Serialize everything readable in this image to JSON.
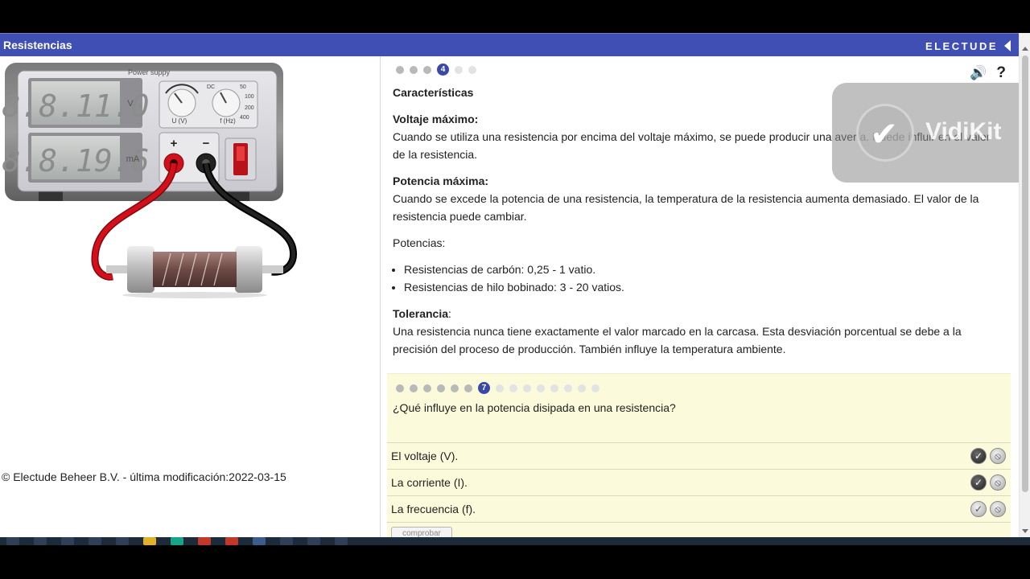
{
  "app": {
    "title": "Resistencias",
    "brand": "ELECTUDE"
  },
  "left": {
    "device_label": "Power suppy",
    "display_voltage": "8.8.11.0",
    "display_voltage_unit": "V",
    "display_current": "8.8.19.6",
    "display_current_unit": "mA",
    "knob_u_label": "U (V)",
    "knob_f_label": "f (Hz)",
    "knob_f_dc": "DC",
    "knob_f_50": "50",
    "knob_f_100": "100",
    "knob_f_200": "200",
    "knob_f_400": "400",
    "plus": "+",
    "minus": "−",
    "copyright": "© Electude Beheer B.V. - última modificación:2022-03-15"
  },
  "content": {
    "pager_active": "4",
    "heading": "Características",
    "sections": [
      {
        "title": "Voltaje máximo:",
        "text": "Cuando se utiliza una resistencia por encima del voltaje máximo, se puede producir una avería. Puede influir en el valor de la resistencia."
      },
      {
        "title": "Potencia máxima:",
        "text": "Cuando se excede la potencia de una resistencia, la temperatura de la resistencia aumenta demasiado. El valor de la resistencia puede cambiar."
      }
    ],
    "potencias_label": "Potencias:",
    "bullets": [
      "Resistencias de carbón: 0,25 - 1 vatio.",
      "Resistencias de hilo bobinado: 3 - 20 vatios."
    ],
    "tolerancia_title": "Tolerancia",
    "tolerancia_colon": ":",
    "tolerancia_text": "Una resistencia nunca tiene exactamente el valor marcado en la carcasa. Esta desviación porcentual se debe a la precisión del proceso de producción. También influye la temperatura ambiente."
  },
  "icons": {
    "speaker": "🔊",
    "help": "?"
  },
  "watermark": {
    "name": "VidiKit"
  },
  "quiz": {
    "pager_active": "7",
    "question": "¿Qué influye en la potencia disipada en una resistencia?",
    "options": [
      {
        "label": "El voltaje (V)."
      },
      {
        "label": "La corriente (I)."
      },
      {
        "label": "La frecuencia (f)."
      }
    ],
    "check_label": "comprobar"
  },
  "colors": {
    "titlebar": "#3f4fb3",
    "quiz_bg": "#fbfbdc",
    "accent": "#3a48a8"
  }
}
